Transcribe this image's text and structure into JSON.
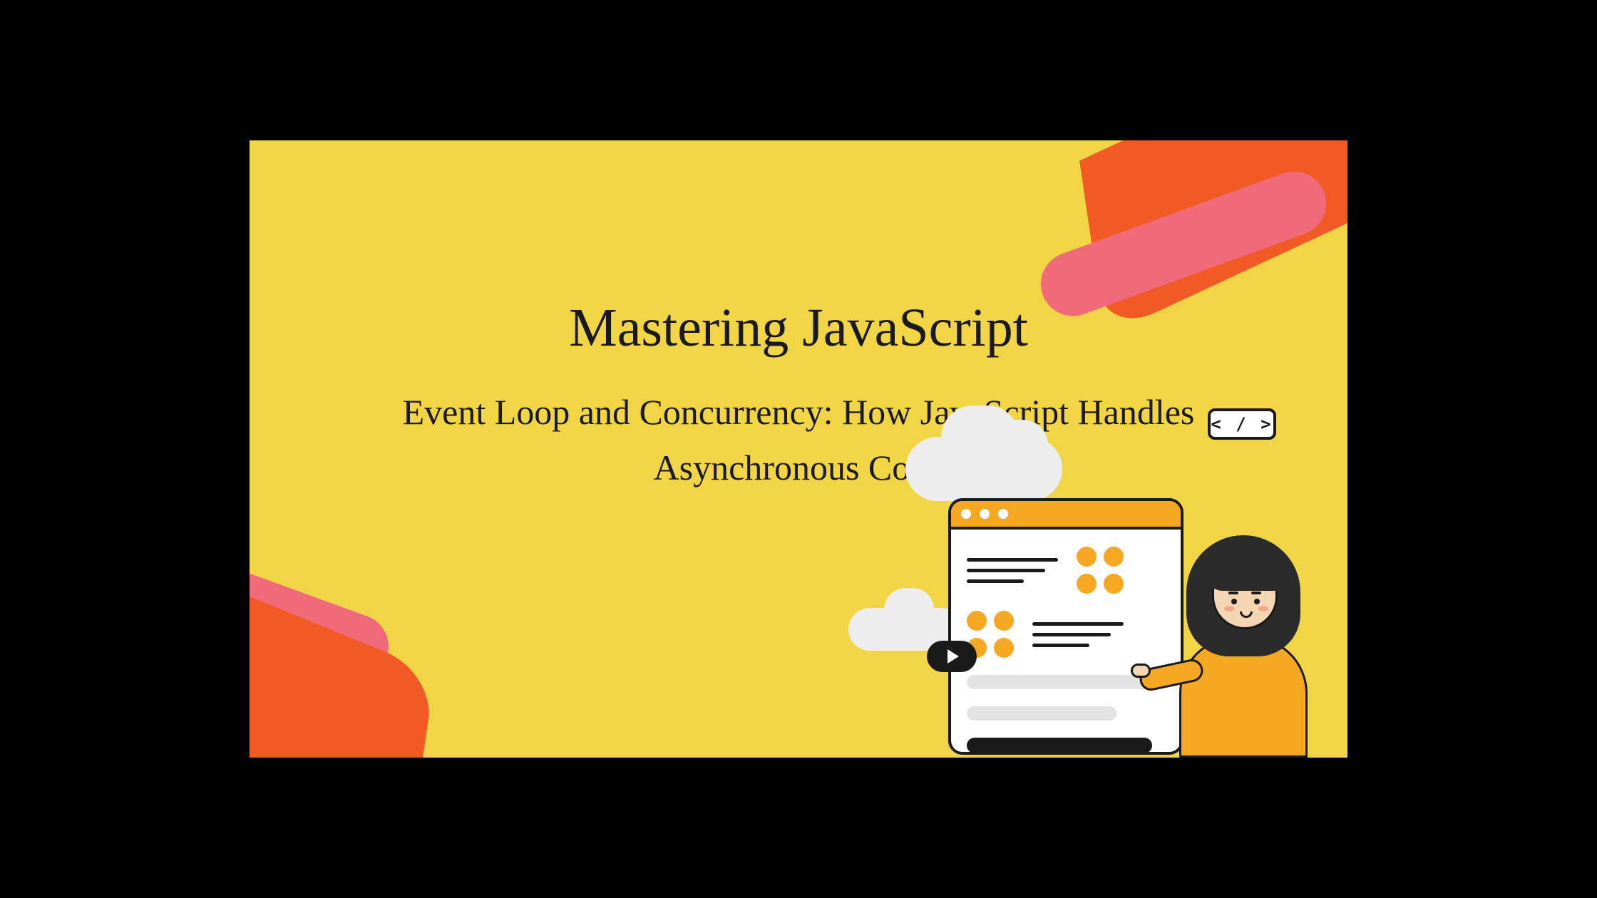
{
  "title": "Mastering JavaScript",
  "subtitle": "Event Loop and Concurrency: How JavaScript Handles Asynchronous Code",
  "code_tag": "< / >",
  "colors": {
    "background": "#f2d544",
    "accent_orange": "#f15a24",
    "accent_pink": "#f06a7a",
    "accent_yellow": "#f7a823",
    "text": "#1a1a1a"
  },
  "icons": {
    "code": "code-icon",
    "play": "play-icon",
    "cloud": "cloud-icon",
    "browser": "browser-window-icon",
    "person": "person-illustration"
  }
}
